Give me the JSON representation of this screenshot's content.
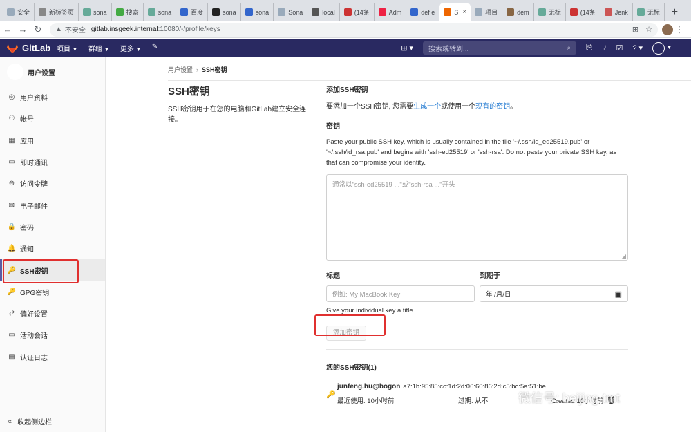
{
  "browser": {
    "tabs": [
      {
        "label": "安全",
        "color": "#9ab"
      },
      {
        "label": "新标签页",
        "color": "#888"
      },
      {
        "label": "sona",
        "color": "#6a9"
      },
      {
        "label": "搜索",
        "color": "#4a4"
      },
      {
        "label": "sona",
        "color": "#6a9"
      },
      {
        "label": "百度",
        "color": "#36c"
      },
      {
        "label": "sona",
        "color": "#222"
      },
      {
        "label": "sona",
        "color": "#36c"
      },
      {
        "label": "Sona",
        "color": "#9ab"
      },
      {
        "label": "local",
        "color": "#555"
      },
      {
        "label": "(14条",
        "color": "#c33"
      },
      {
        "label": "Adm",
        "color": "#e24"
      },
      {
        "label": "def e",
        "color": "#36c"
      },
      {
        "label": "S",
        "color": "#e60"
      },
      {
        "label": "项目",
        "color": "#9ab"
      },
      {
        "label": "dem",
        "color": "#864"
      },
      {
        "label": "无标",
        "color": "#6a9"
      },
      {
        "label": "(14条",
        "color": "#c33"
      },
      {
        "label": "Jenk",
        "color": "#c55"
      },
      {
        "label": "无标",
        "color": "#6a9"
      }
    ],
    "active_tab": 13,
    "insecure_label": "不安全",
    "url_host": "gitlab.insgeek.internal",
    "url_path": ":10080/-/profile/keys",
    "new_tab": "+"
  },
  "gitlab": {
    "brand": "GitLab",
    "menu": [
      "项目",
      "群组",
      "更多"
    ],
    "search_placeholder": "搜索或转到..."
  },
  "sidebar": {
    "title": "用户设置",
    "items": [
      {
        "label": "用户资料",
        "icon": "profile-icon",
        "glyph": "◎"
      },
      {
        "label": "帐号",
        "icon": "account-icon",
        "glyph": "⚇"
      },
      {
        "label": "应用",
        "icon": "applications-icon",
        "glyph": "▦"
      },
      {
        "label": "即时通讯",
        "icon": "chat-icon",
        "glyph": "▭"
      },
      {
        "label": "访问令牌",
        "icon": "token-icon",
        "glyph": "⊖"
      },
      {
        "label": "电子邮件",
        "icon": "mail-icon",
        "glyph": "✉"
      },
      {
        "label": "密码",
        "icon": "lock-icon",
        "glyph": "🔒"
      },
      {
        "label": "通知",
        "icon": "bell-icon",
        "glyph": "🔔"
      },
      {
        "label": "SSH密钥",
        "icon": "key-icon",
        "glyph": "🔑"
      },
      {
        "label": "GPG密钥",
        "icon": "key-icon",
        "glyph": "🔑"
      },
      {
        "label": "偏好设置",
        "icon": "preferences-icon",
        "glyph": "⇄"
      },
      {
        "label": "活动会话",
        "icon": "monitor-icon",
        "glyph": "▭"
      },
      {
        "label": "认证日志",
        "icon": "log-icon",
        "glyph": "▤"
      }
    ],
    "active_index": 8,
    "collapse_label": "收起侧边栏"
  },
  "breadcrumb": {
    "parent": "用户设置",
    "current": "SSH密钥"
  },
  "page": {
    "title": "SSH密钥",
    "description": "SSH密钥用于在您的电脑和GitLab建立安全连接。"
  },
  "form": {
    "section_title": "添加SSH密钥",
    "intro_prefix": "要添加一个SSH密钥, 您需要",
    "intro_link1": "生成一个",
    "intro_mid": "或使用一个",
    "intro_link2": "现有的密钥",
    "intro_suffix": "。",
    "key_label": "密钥",
    "key_help": "Paste your public SSH key, which is usually contained in the file '~/.ssh/id_ed25519.pub' or '~/.ssh/id_rsa.pub' and begins with 'ssh-ed25519' or 'ssh-rsa'. Do not paste your private SSH key, as that can compromise your identity.",
    "key_placeholder": "通常以\"ssh-ed25519 ...\"或\"ssh-rsa ...\"开头",
    "title_label": "标题",
    "title_placeholder": "例如: My MacBook Key",
    "expires_label": "到期于",
    "expires_value": "年 /月/日",
    "title_hint": "Give your individual key a title.",
    "submit_label": "添加密钥"
  },
  "keys": {
    "heading": "您的SSH密钥(1)",
    "list": [
      {
        "name": "junfeng.hu@bogon",
        "fingerprint": "a7:1b:95:85:cc:1d:2d:06:60:86:2d:c5:bc:5a:51:be",
        "last_used_label": "最近使用:",
        "last_used_value": "10小时前",
        "expires_label": "过期:",
        "expires_value": "从不",
        "created": "Created 10小时前"
      }
    ]
  },
  "watermark": "微信号: beijing-tmt",
  "colors": {
    "header": "#292961",
    "link": "#1f78d1",
    "highlight": "#e0302f"
  }
}
